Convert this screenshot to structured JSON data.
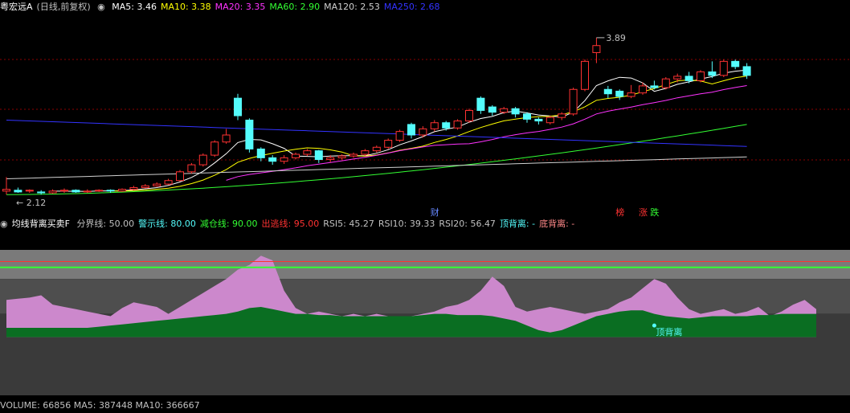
{
  "header": {
    "stock": "粤宏远A",
    "period": "(日线,前复权)",
    "ma_items": [
      {
        "label": "MA5: 3.46",
        "color": "#ffffff"
      },
      {
        "label": "MA10: 3.38",
        "color": "#ffff00"
      },
      {
        "label": "MA20: 3.35",
        "color": "#ff33ff"
      },
      {
        "label": "MA60: 2.90",
        "color": "#33ff33"
      },
      {
        "label": "MA120: 2.53",
        "color": "#d0d0d0"
      },
      {
        "label": "MA250: 2.68",
        "color": "#3333ff"
      }
    ]
  },
  "colors": {
    "up": "#ff3232",
    "down": "#54fcfc",
    "grid": "#8b0000",
    "pink": "#cc88cc",
    "green": "#0a6e22",
    "ma5": "#ffffff",
    "ma10": "#ffff00",
    "ma20": "#ff33ff",
    "ma60": "#33ff33",
    "ma120": "#d0d0d0",
    "ma250": "#3333ff"
  },
  "chart_data": [
    {
      "type": "candlestick",
      "ylim": [
        1.9,
        4.1
      ],
      "annotations": {
        "high_label": "3.89",
        "low_label": "2.12"
      },
      "markers": [
        {
          "text": "财",
          "color": "#6688ff"
        },
        {
          "text": "榜",
          "color": "#ff3232"
        },
        {
          "text": "涨",
          "color": "#ff3232"
        },
        {
          "text": "跌",
          "color": "#33ff33"
        }
      ],
      "candles": [
        {
          "o": 2.14,
          "c": 2.16,
          "h": 2.3,
          "l": 2.1
        },
        {
          "o": 2.15,
          "c": 2.13,
          "h": 2.18,
          "l": 2.12
        },
        {
          "o": 2.14,
          "c": 2.15,
          "h": 2.16,
          "l": 2.12
        },
        {
          "o": 2.13,
          "c": 2.12,
          "h": 2.15,
          "l": 2.1
        },
        {
          "o": 2.12,
          "c": 2.14,
          "h": 2.16,
          "l": 2.11
        },
        {
          "o": 2.14,
          "c": 2.15,
          "h": 2.17,
          "l": 2.12
        },
        {
          "o": 2.15,
          "c": 2.13,
          "h": 2.16,
          "l": 2.12
        },
        {
          "o": 2.13,
          "c": 2.14,
          "h": 2.16,
          "l": 2.12
        },
        {
          "o": 2.14,
          "c": 2.15,
          "h": 2.16,
          "l": 2.13
        },
        {
          "o": 2.15,
          "c": 2.14,
          "h": 2.16,
          "l": 2.12
        },
        {
          "o": 2.14,
          "c": 2.16,
          "h": 2.17,
          "l": 2.13
        },
        {
          "o": 2.16,
          "c": 2.18,
          "h": 2.2,
          "l": 2.15
        },
        {
          "o": 2.18,
          "c": 2.2,
          "h": 2.22,
          "l": 2.17
        },
        {
          "o": 2.2,
          "c": 2.22,
          "h": 2.24,
          "l": 2.19
        },
        {
          "o": 2.22,
          "c": 2.26,
          "h": 2.28,
          "l": 2.21
        },
        {
          "o": 2.26,
          "c": 2.36,
          "h": 2.38,
          "l": 2.25
        },
        {
          "o": 2.36,
          "c": 2.44,
          "h": 2.46,
          "l": 2.34
        },
        {
          "o": 2.44,
          "c": 2.55,
          "h": 2.57,
          "l": 2.42
        },
        {
          "o": 2.55,
          "c": 2.7,
          "h": 2.72,
          "l": 2.53
        },
        {
          "o": 2.7,
          "c": 2.78,
          "h": 2.85,
          "l": 2.68
        },
        {
          "o": 3.2,
          "c": 3.0,
          "h": 3.25,
          "l": 2.95
        },
        {
          "o": 2.95,
          "c": 2.62,
          "h": 2.97,
          "l": 2.58
        },
        {
          "o": 2.62,
          "c": 2.52,
          "h": 2.64,
          "l": 2.48
        },
        {
          "o": 2.52,
          "c": 2.48,
          "h": 2.55,
          "l": 2.44
        },
        {
          "o": 2.48,
          "c": 2.52,
          "h": 2.55,
          "l": 2.45
        },
        {
          "o": 2.52,
          "c": 2.56,
          "h": 2.58,
          "l": 2.5
        },
        {
          "o": 2.56,
          "c": 2.6,
          "h": 2.62,
          "l": 2.54
        },
        {
          "o": 2.6,
          "c": 2.5,
          "h": 2.61,
          "l": 2.46
        },
        {
          "o": 2.5,
          "c": 2.52,
          "h": 2.55,
          "l": 2.47
        },
        {
          "o": 2.52,
          "c": 2.54,
          "h": 2.56,
          "l": 2.5
        },
        {
          "o": 2.54,
          "c": 2.56,
          "h": 2.58,
          "l": 2.52
        },
        {
          "o": 2.56,
          "c": 2.6,
          "h": 2.62,
          "l": 2.54
        },
        {
          "o": 2.6,
          "c": 2.64,
          "h": 2.66,
          "l": 2.58
        },
        {
          "o": 2.64,
          "c": 2.72,
          "h": 2.74,
          "l": 2.62
        },
        {
          "o": 2.72,
          "c": 2.82,
          "h": 2.84,
          "l": 2.7
        },
        {
          "o": 2.9,
          "c": 2.78,
          "h": 2.92,
          "l": 2.74
        },
        {
          "o": 2.78,
          "c": 2.85,
          "h": 2.88,
          "l": 2.75
        },
        {
          "o": 2.85,
          "c": 2.92,
          "h": 2.95,
          "l": 2.82
        },
        {
          "o": 2.92,
          "c": 2.86,
          "h": 2.94,
          "l": 2.83
        },
        {
          "o": 2.86,
          "c": 2.94,
          "h": 2.96,
          "l": 2.84
        },
        {
          "o": 2.94,
          "c": 3.06,
          "h": 3.08,
          "l": 2.92
        },
        {
          "o": 3.2,
          "c": 3.06,
          "h": 3.22,
          "l": 3.02
        },
        {
          "o": 3.1,
          "c": 3.04,
          "h": 3.12,
          "l": 3.0
        },
        {
          "o": 3.04,
          "c": 3.08,
          "h": 3.1,
          "l": 3.02
        },
        {
          "o": 3.08,
          "c": 3.02,
          "h": 3.1,
          "l": 2.98
        },
        {
          "o": 3.02,
          "c": 2.96,
          "h": 3.04,
          "l": 2.92
        },
        {
          "o": 2.96,
          "c": 2.94,
          "h": 2.98,
          "l": 2.9
        },
        {
          "o": 2.92,
          "c": 2.98,
          "h": 3.0,
          "l": 2.9
        },
        {
          "o": 2.98,
          "c": 3.02,
          "h": 3.04,
          "l": 2.95
        },
        {
          "o": 3.02,
          "c": 3.3,
          "h": 3.32,
          "l": 3.0
        },
        {
          "o": 3.3,
          "c": 3.62,
          "h": 3.64,
          "l": 3.28
        },
        {
          "o": 3.72,
          "c": 3.8,
          "h": 3.89,
          "l": 3.6
        },
        {
          "o": 3.3,
          "c": 3.25,
          "h": 3.34,
          "l": 3.2
        },
        {
          "o": 3.28,
          "c": 3.22,
          "h": 3.3,
          "l": 3.18
        },
        {
          "o": 3.22,
          "c": 3.26,
          "h": 3.35,
          "l": 3.2
        },
        {
          "o": 3.26,
          "c": 3.34,
          "h": 3.38,
          "l": 3.24
        },
        {
          "o": 3.34,
          "c": 3.32,
          "h": 3.4,
          "l": 3.3
        },
        {
          "o": 3.32,
          "c": 3.42,
          "h": 3.44,
          "l": 3.3
        },
        {
          "o": 3.42,
          "c": 3.45,
          "h": 3.48,
          "l": 3.38
        },
        {
          "o": 3.45,
          "c": 3.4,
          "h": 3.5,
          "l": 3.37
        },
        {
          "o": 3.4,
          "c": 3.5,
          "h": 3.52,
          "l": 3.38
        },
        {
          "o": 3.5,
          "c": 3.46,
          "h": 3.62,
          "l": 3.43
        },
        {
          "o": 3.46,
          "c": 3.62,
          "h": 3.64,
          "l": 3.44
        },
        {
          "o": 3.62,
          "c": 3.56,
          "h": 3.64,
          "l": 3.53
        },
        {
          "o": 3.56,
          "c": 3.46,
          "h": 3.6,
          "l": 3.42
        }
      ]
    },
    {
      "type": "area",
      "title": "均线背离买卖F",
      "ylim": [
        -20,
        105
      ],
      "legend_items": [
        {
          "label": "分界线: 50.00",
          "color": "#c0c0c0"
        },
        {
          "label": "警示线: 80.00",
          "color": "#54fcfc"
        },
        {
          "label": "减仓线: 90.00",
          "color": "#33ff33"
        },
        {
          "label": "出逃线: 95.00",
          "color": "#ff3232"
        },
        {
          "label": "RSI5: 45.27",
          "color": "#c0c0c0"
        },
        {
          "label": "RSI10: 39.33",
          "color": "#c0c0c0"
        },
        {
          "label": "RSI20: 56.47",
          "color": "#c0c0c0"
        },
        {
          "label": "顶背离: -",
          "color": "#54fcfc"
        },
        {
          "label": "底背离: -",
          "color": "#ff8888"
        }
      ],
      "levels": [
        50,
        80,
        90,
        95
      ],
      "annotation": "顶背离",
      "series": [
        {
          "values": [
            62,
            63,
            64,
            66,
            58,
            56,
            54,
            52,
            50,
            48,
            55,
            60,
            58,
            56,
            50,
            56,
            62,
            68,
            74,
            80,
            88,
            92,
            100,
            96,
            70,
            55,
            50,
            52,
            50,
            48,
            50,
            48,
            50,
            48,
            47,
            48,
            50,
            52,
            56,
            58,
            62,
            70,
            82,
            74,
            56,
            52,
            54,
            56,
            54,
            52,
            50,
            52,
            54,
            60,
            64,
            72,
            80,
            76,
            64,
            54,
            50,
            52,
            54,
            50,
            52,
            56,
            48,
            52,
            58,
            62,
            54
          ]
        },
        {
          "values": [
            38,
            38,
            38,
            38,
            38,
            38,
            38,
            38,
            39,
            40,
            41,
            42,
            43,
            44,
            45,
            46,
            47,
            48,
            49,
            50,
            52,
            55,
            56,
            54,
            52,
            50,
            50,
            49,
            49,
            48,
            48,
            48,
            48,
            48,
            48,
            48,
            49,
            50,
            50,
            49,
            49,
            49,
            48,
            46,
            44,
            40,
            36,
            34,
            36,
            40,
            44,
            48,
            50,
            52,
            53,
            53,
            50,
            48,
            47,
            46,
            47,
            48,
            48,
            48,
            48,
            49,
            49,
            50,
            50,
            50,
            50
          ]
        }
      ]
    }
  ],
  "volume_bar": {
    "text": "VOLUME: 66856  MA5: 387448  MA10: 366667"
  }
}
